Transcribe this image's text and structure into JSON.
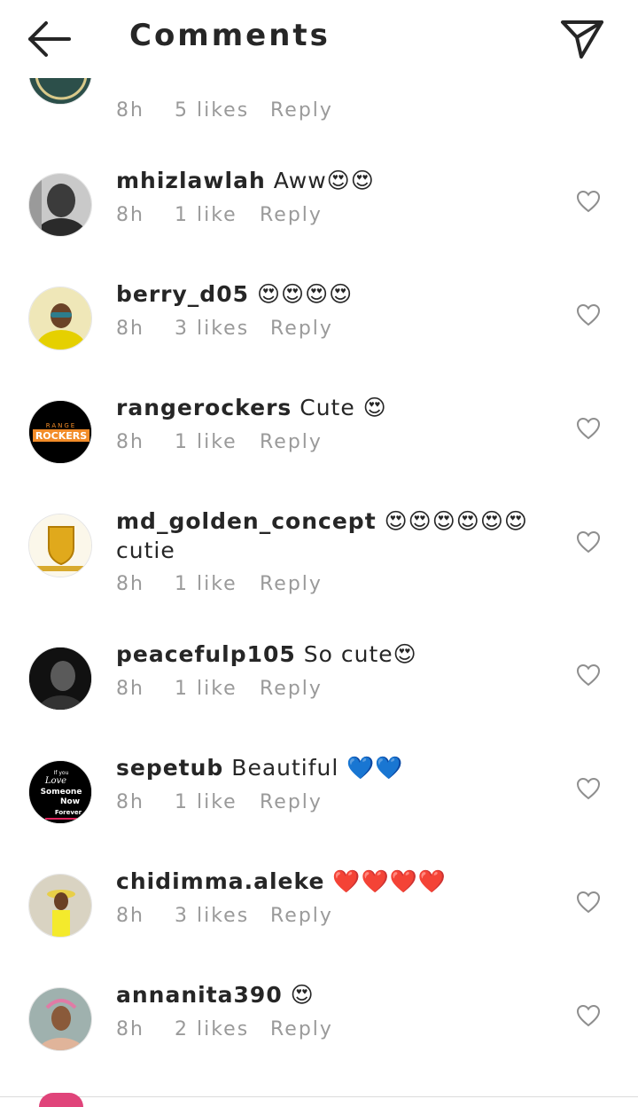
{
  "header": {
    "title": "Comments",
    "back_icon": "arrow-left-icon",
    "send_icon": "paper-plane-icon"
  },
  "comments": [
    {
      "username": "",
      "text": "",
      "time": "8h",
      "likes": "5 likes",
      "reply": "Reply"
    },
    {
      "username": "mhizlawlah",
      "text": "Aww😍😍",
      "time": "8h",
      "likes": "1 like",
      "reply": "Reply"
    },
    {
      "username": "berry_d05",
      "text": "😍😍😍😍",
      "time": "8h",
      "likes": "3 likes",
      "reply": "Reply"
    },
    {
      "username": "rangerockers",
      "text": "Cute 😍",
      "time": "8h",
      "likes": "1 like",
      "reply": "Reply"
    },
    {
      "username": "md_golden_concept",
      "text": "😍😍😍😍😍😍 cutie",
      "time": "8h",
      "likes": "1 like",
      "reply": "Reply"
    },
    {
      "username": "peacefulp105",
      "text": "So cute😍",
      "time": "8h",
      "likes": "1 like",
      "reply": "Reply"
    },
    {
      "username": "sepetub",
      "text": "Beautiful 💙💙",
      "time": "8h",
      "likes": "1 like",
      "reply": "Reply"
    },
    {
      "username": "chidimma.aleke",
      "text": "❤️❤️❤️❤️",
      "time": "8h",
      "likes": "3 likes",
      "reply": "Reply"
    },
    {
      "username": "annanita390",
      "text": "😍",
      "time": "8h",
      "likes": "2 likes",
      "reply": "Reply"
    }
  ],
  "avatars": {
    "rangerockers_logo_top": "RANGE",
    "rangerockers_logo_main": "ROCKERS",
    "sepetub_l1": "If you",
    "sepetub_l2": "Love",
    "sepetub_l3": "Someone",
    "sepetub_l4": "Now",
    "sepetub_l5": "Forever"
  },
  "colors": {
    "text": "#262626",
    "meta": "#9a9a9a",
    "heart_outline": "#8e8e8e",
    "divider": "#dbdbdb"
  }
}
